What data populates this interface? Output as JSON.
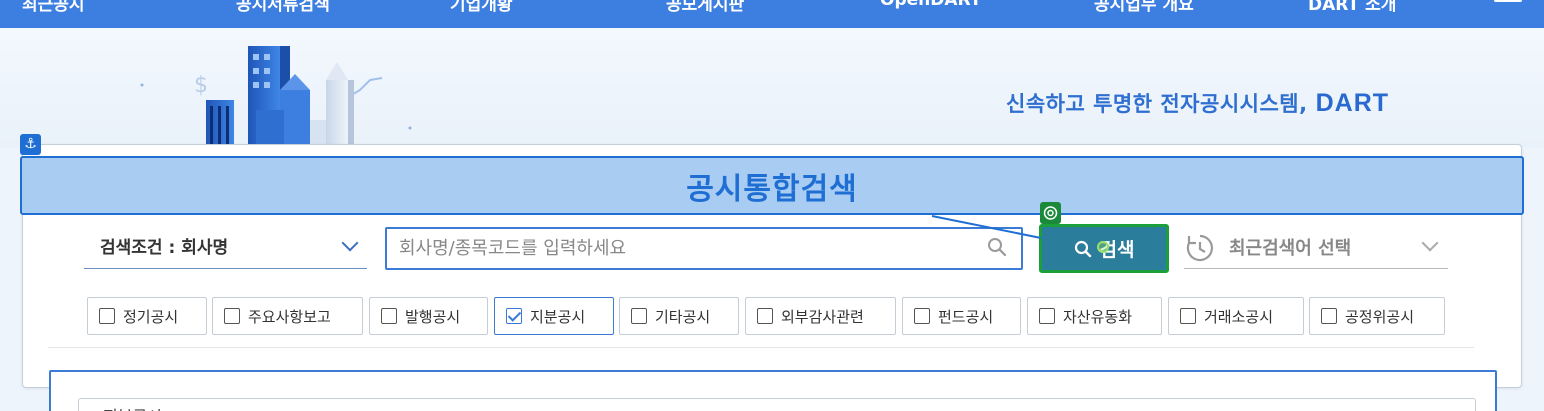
{
  "nav": {
    "items": [
      "최근공시",
      "공시서류검색",
      "기업개황",
      "공모게시판",
      "OpenDART",
      "공시업무 개요",
      "DART 소개"
    ]
  },
  "hero": {
    "slogan": "신속하고 투명한 전자공시시스템,",
    "brand": "DART"
  },
  "search": {
    "title": "공시통합검색",
    "condition_label": "검색조건 : 회사명",
    "placeholder": "회사명/종목코드를 입력하세요",
    "value": "",
    "button_label": "검색",
    "recent_label": "최근검색어 선택"
  },
  "filters": [
    {
      "label": "정기공시",
      "checked": false
    },
    {
      "label": "주요사항보고",
      "checked": false
    },
    {
      "label": "발행공시",
      "checked": false
    },
    {
      "label": "지분공시",
      "checked": true
    },
    {
      "label": "기타공시",
      "checked": false
    },
    {
      "label": "외부감사관련",
      "checked": false
    },
    {
      "label": "펀드공시",
      "checked": false
    },
    {
      "label": "자산유동화",
      "checked": false
    },
    {
      "label": "거래소공시",
      "checked": false
    },
    {
      "label": "공정위공시",
      "checked": false
    }
  ],
  "results": {
    "section_label": "지분공시"
  },
  "colors": {
    "nav_bg": "#3d7fe0",
    "accent": "#1f6ed4",
    "button_bg": "#2b7d9c",
    "button_border": "#1a9f3a",
    "title_bg": "#a9ccf3"
  },
  "icons": {
    "anchor": "anchor-icon",
    "target": "target-icon",
    "search": "search-icon",
    "clock": "history-clock-icon",
    "menu": "hamburger-menu-icon",
    "chevron": "chevron-down-icon"
  }
}
